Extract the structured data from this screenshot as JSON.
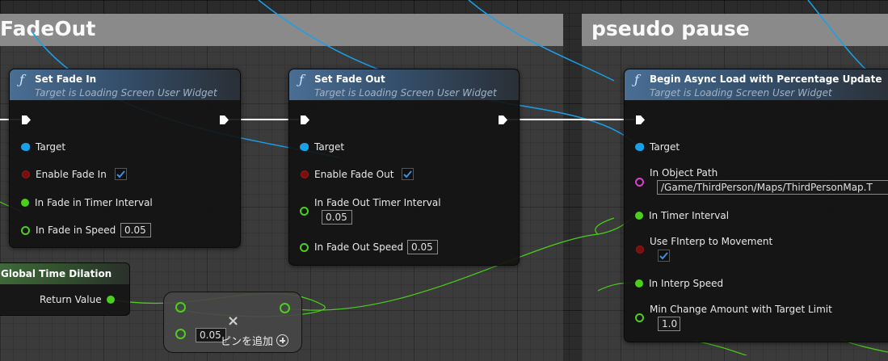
{
  "comments": {
    "fadeout": "FadeOut",
    "pseudo_pause": "pseudo pause"
  },
  "colors": {
    "exec_wire": "#ffffff",
    "object_wire": "#1aa0e8",
    "float_wire": "#4ad01a",
    "function_header": "#4a6e94"
  },
  "nodes": {
    "set_fade_in": {
      "title": "Set Fade In",
      "subtitle": "Target is Loading Screen User Widget",
      "pins": {
        "target": "Target",
        "enable": "Enable Fade In",
        "timer": "In Fade in Timer Interval",
        "speed": "In Fade in Speed",
        "speed_value": "0.05"
      },
      "enable_checked": true
    },
    "set_fade_out": {
      "title": "Set Fade Out",
      "subtitle": "Target is Loading Screen User Widget",
      "pins": {
        "target": "Target",
        "enable": "Enable Fade Out",
        "timer": "In Fade Out Timer Interval",
        "timer_value": "0.05",
        "speed": "In Fade Out Speed",
        "speed_value": "0.05"
      },
      "enable_checked": true
    },
    "begin_async": {
      "title": "Begin Async Load with Percentage Update",
      "subtitle": "Target is Loading Screen User Widget",
      "pins": {
        "target": "Target",
        "object_path": "In Object Path",
        "object_path_value": "/Game/ThirdPerson/Maps/ThirdPersonMap.T",
        "timer": "In Timer Interval",
        "use_finterp": "Use FInterp to Movement",
        "interp_speed": "In Interp Speed",
        "min_change": "Min Change Amount with Target Limit",
        "min_change_value": "1.0"
      },
      "use_finterp_checked": true
    },
    "global_time_dilation": {
      "title": "Global Time Dilation",
      "return_value": "Return Value"
    },
    "multiply": {
      "operator": "×",
      "value": "0.05",
      "add_pin": "ピンを追加"
    }
  }
}
